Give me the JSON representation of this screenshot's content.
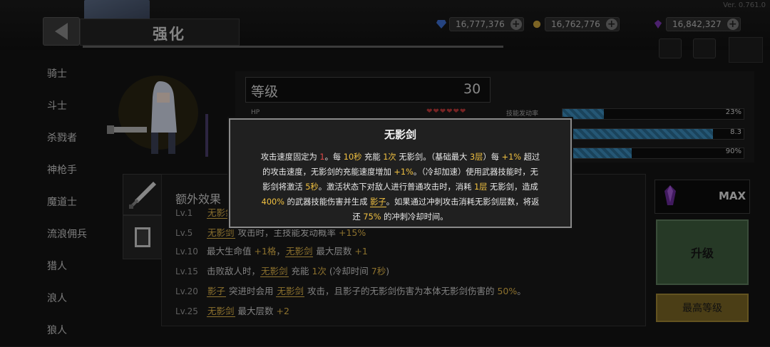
{
  "app": {
    "version": "Ver. 0.761.0"
  },
  "header": {
    "title": "强化"
  },
  "currencies": [
    {
      "name": "blue-gem",
      "value": "16,777,376",
      "color": "#3c6fd1"
    },
    {
      "name": "coin",
      "value": "16,762,776",
      "color": "#c9a23a"
    },
    {
      "name": "purple-crystal",
      "value": "16,842,327",
      "color": "#7a36b0"
    }
  ],
  "classes": [
    "骑士",
    "斗士",
    "杀戮者",
    "神枪手",
    "魔道士",
    "流浪佣兵",
    "猎人",
    "浪人",
    "狼人"
  ],
  "stats": {
    "level_label": "等级",
    "level_value": "30",
    "hp_label": "HP",
    "hp_hearts": "❤❤❤❤❤❤",
    "bars": [
      {
        "label": "技能发动率",
        "value": "23%",
        "fill": 0.23
      },
      {
        "label": "",
        "value": "8.3",
        "fill": 0.83
      },
      {
        "label": "",
        "value": "90%",
        "fill": 0.38
      }
    ]
  },
  "extra": {
    "title": "额外效果",
    "rows": [
      {
        "lv": "Lv.1",
        "parts": [
          {
            "k": "无影剑"
          }
        ]
      },
      {
        "lv": "Lv.5",
        "parts": [
          {
            "k": "无影剑"
          },
          {
            "t": " 攻击时，主技能发动概率 "
          },
          {
            "n": "+15%"
          }
        ]
      },
      {
        "lv": "Lv.10",
        "parts": [
          {
            "t": "最大生命值 "
          },
          {
            "n": "+1格"
          },
          {
            "t": "，"
          },
          {
            "k": "无影剑"
          },
          {
            "t": " 最大层数 "
          },
          {
            "n": "+1"
          }
        ]
      },
      {
        "lv": "Lv.15",
        "parts": [
          {
            "t": "击败敌人时，"
          },
          {
            "k": "无影剑"
          },
          {
            "t": " 充能 "
          },
          {
            "n": "1次"
          },
          {
            "t": " (冷却时间 "
          },
          {
            "n": "7秒"
          },
          {
            "t": ")"
          }
        ]
      },
      {
        "lv": "Lv.20",
        "parts": [
          {
            "k": "影子"
          },
          {
            "t": " 突进时会用 "
          },
          {
            "k": "无影剑"
          },
          {
            "t": " 攻击，且影子的无影剑伤害为本体无影剑伤害的 "
          },
          {
            "n": "50%"
          },
          {
            "t": "。"
          }
        ]
      },
      {
        "lv": "Lv.25",
        "parts": [
          {
            "k": "无影剑"
          },
          {
            "t": " 最大层数 "
          },
          {
            "n": "+2"
          }
        ]
      }
    ]
  },
  "right": {
    "max_label": "MAX",
    "upgrade_label": "升级",
    "max_level_label": "最高等级"
  },
  "tooltip": {
    "title": "无影剑",
    "lines": [
      [
        {
          "t": "攻击速度固定为 "
        },
        {
          "r": "1"
        },
        {
          "t": "。每 "
        },
        {
          "g": "10秒"
        },
        {
          "t": " 充能 "
        },
        {
          "g": "1次"
        },
        {
          "t": " 无影剑。（基础最大 "
        },
        {
          "g": "3层"
        },
        {
          "t": "）每 "
        },
        {
          "g": "+1%"
        },
        {
          "t": " 超过"
        }
      ],
      [
        {
          "t": "的攻击速度，无影剑的充能速度增加 "
        },
        {
          "g": "+1%"
        },
        {
          "t": "。（冷却加速）使用武器技能时，无"
        }
      ],
      [
        {
          "t": "影剑将激活 "
        },
        {
          "g": "5秒"
        },
        {
          "t": "。激活状态下对敌人进行普通攻击时，消耗 "
        },
        {
          "g": "1层"
        },
        {
          "t": " 无影剑，造成"
        }
      ],
      [
        {
          "g": "400%"
        },
        {
          "t": " 的武器技能伤害并生成 "
        },
        {
          "k": "影子"
        },
        {
          "t": "。如果通过冲刺攻击消耗无影剑层数，将返"
        }
      ],
      [
        {
          "t": "还 "
        },
        {
          "g": "75%"
        },
        {
          "t": " 的冲刺冷却时间。"
        }
      ]
    ]
  }
}
